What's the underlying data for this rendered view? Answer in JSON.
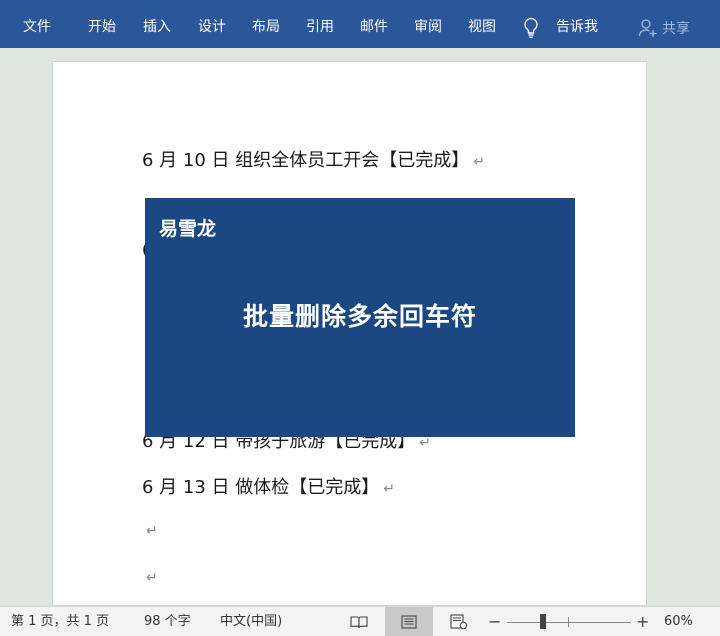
{
  "ribbon": {
    "tabs": {
      "file": "文件",
      "home": "开始",
      "insert": "插入",
      "design": "设计",
      "layout": "布局",
      "references": "引用",
      "mailings": "邮件",
      "review": "审阅",
      "view": "视图"
    },
    "tell_me": "告诉我",
    "share": "共享",
    "background_color": "#2b579a"
  },
  "document": {
    "lines": [
      "6 月 10 日  组织全体员工开会【已完成】",
      "6",
      "",
      "",
      "",
      "6 月 12 日  带孩子旅游【已完成】",
      "6 月 13 日  做体检【已完成】",
      "",
      ""
    ],
    "return_mark": "↵"
  },
  "banner": {
    "brand": "易雪龙",
    "headline": "批量删除多余回车符",
    "background_color": "#1b4882"
  },
  "status_bar": {
    "page_count": "第 1 页，共 1 页",
    "word_count": "98 个字",
    "language": "中文(中国)",
    "zoom_minus": "−",
    "zoom_plus": "+",
    "zoom_level": "60%",
    "zoom_fraction": 0.6
  }
}
